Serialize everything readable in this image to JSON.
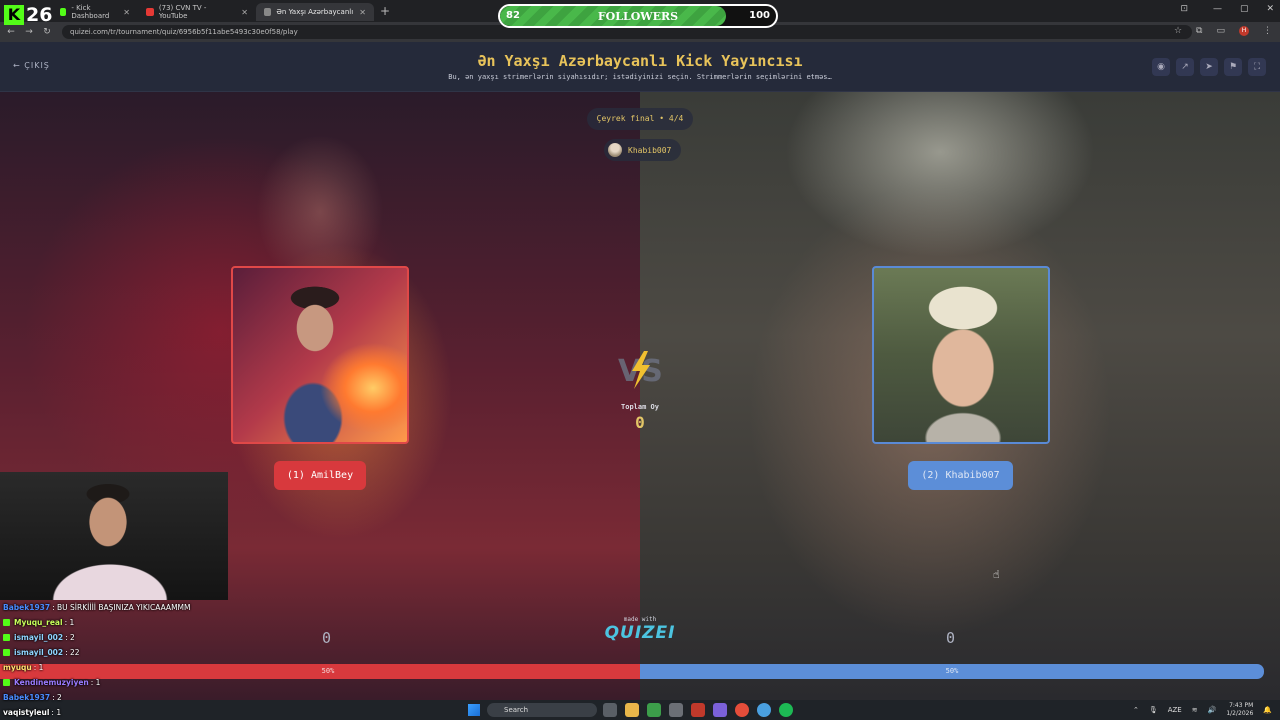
{
  "overlay": {
    "kick_count": "26",
    "followers": {
      "current": "82",
      "label": "FOLLOWERS",
      "max": "100",
      "progress": 0.82
    }
  },
  "browser": {
    "tabs": [
      {
        "label": "- Kick Dashboard",
        "icon": "kick-icon",
        "active": false
      },
      {
        "label": "(73) CVN TV - YouTube",
        "icon": "youtube-icon",
        "active": false
      },
      {
        "label": "Ən Yaxşı Azərbaycanlı Kick Yay...",
        "icon": "quizei-icon",
        "active": true
      }
    ],
    "url": "quizei.com/tr/tournament/quiz/6956b5f11abe5493c30e0f58/play"
  },
  "page": {
    "back_label": "ÇIKIŞ",
    "title": "Ən Yaxşı Azərbaycanlı Kick Yayıncısı",
    "subtitle": "Bu, ən yaxşı strimerlərin siyahısıdır; istədiyinizi seçin. Strimmerlərin seçimlərini etməs…",
    "round": "Çeyrek final • 4/4",
    "current_user": "Khabib007",
    "vs_label": "VS",
    "total_votes_label": "Toplam Oy",
    "total_votes_value": "0",
    "left": {
      "name": "(1) AmilBey",
      "votes": "0",
      "percent": "50%",
      "share": 0.5
    },
    "right": {
      "name": "(2) Khabib007",
      "votes": "0",
      "percent": "50%",
      "share": 0.5
    },
    "made_with": "made with",
    "brand": "QUIZEI"
  },
  "chat": [
    {
      "user": "Babek1937",
      "message": ": BU SİRKİİİİ BAŞINIZA YIKICAAAMMM",
      "color": "#4a8cff",
      "badge": false
    },
    {
      "user": "Myuqu_real",
      "message": ": 1",
      "color": "#c8ff5a",
      "badge": true
    },
    {
      "user": "ismayil_002",
      "message": ": 2",
      "color": "#8fd4ff",
      "badge": true
    },
    {
      "user": "ismayil_002",
      "message": ": 22",
      "color": "#8fd4ff",
      "badge": true
    },
    {
      "user": "myuqu",
      "message": ": 1",
      "color": "#ffe070",
      "badge": false
    },
    {
      "user": "Kendinemuzyiyen",
      "message": ": 1",
      "color": "#9a7bff",
      "badge": true
    },
    {
      "user": "Babek1937",
      "message": ": 2",
      "color": "#4a8cff",
      "badge": false
    },
    {
      "user": "vaqistyleul",
      "message": ": 1",
      "color": "#ffffff",
      "badge": false
    }
  ],
  "taskbar": {
    "search_placeholder": "Search",
    "language": "AZE",
    "time": "7:43 PM",
    "date": "1/2/2026"
  }
}
